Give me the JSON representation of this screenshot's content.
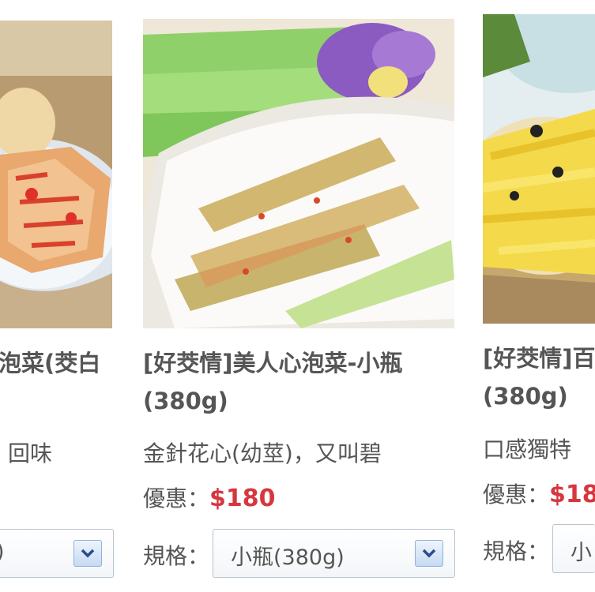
{
  "products": [
    {
      "title_line1": "泡菜(茭白",
      "title_line2": "",
      "desc": "回味",
      "price_label": "",
      "price": "",
      "spec_label": "",
      "spec_value": ")",
      "dropdown_icon": "chevron-down-icon"
    },
    {
      "title_line1": "[好茭情]美人心泡菜-小瓶",
      "title_line2": "(380g)",
      "desc": "金針花心(幼莖)，又叫碧",
      "price_label": "優惠：",
      "price": "$180",
      "spec_label": "規格：",
      "spec_value": "小瓶(380g)",
      "dropdown_icon": "chevron-down-icon"
    },
    {
      "title_line1": "[好茭情]百",
      "title_line2": "(380g)",
      "desc": "口感獨特",
      "price_label": "優惠：",
      "price": "$18",
      "spec_label": "規格：",
      "spec_value": "小",
      "dropdown_icon": "chevron-down-icon"
    }
  ],
  "colors": {
    "price": "#d6373f",
    "text": "#555555",
    "select_border": "#b9c4cf",
    "select_button": "#c7daf3"
  }
}
